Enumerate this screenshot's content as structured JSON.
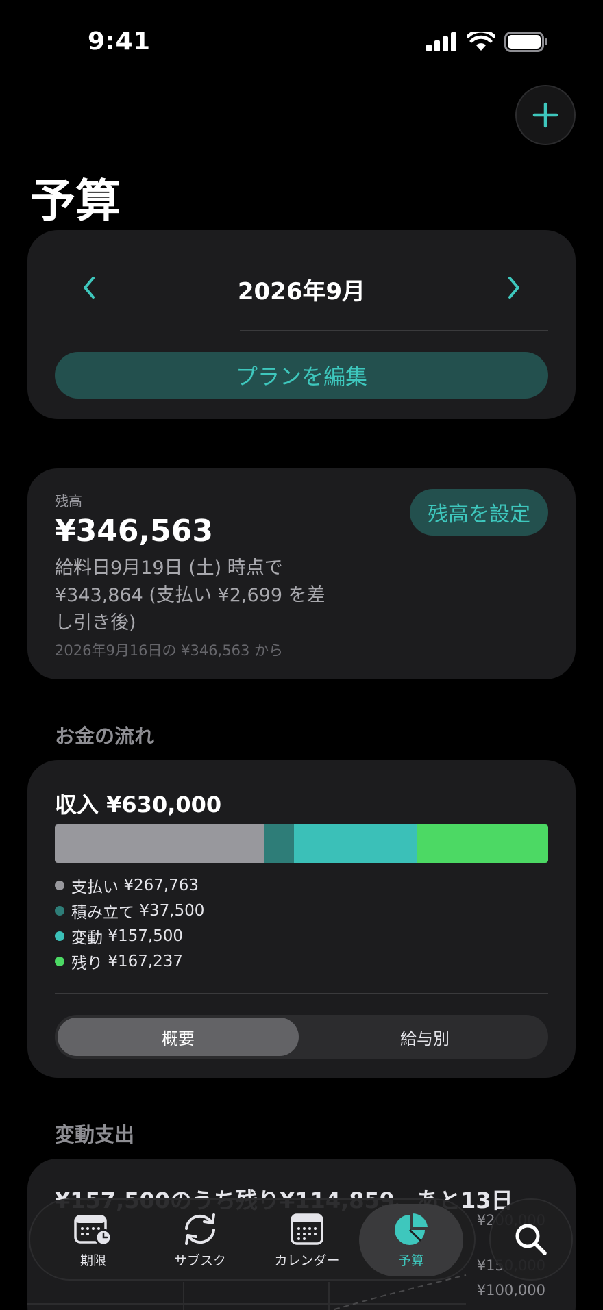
{
  "status": {
    "time": "9:41"
  },
  "page": {
    "title": "予算"
  },
  "month": {
    "label": "2026年9月",
    "edit_plan": "プランを編集"
  },
  "balance": {
    "label": "残高",
    "amount": "¥346,563",
    "description": "給料日9月19日 (土) 時点で ¥343,864 (支払い ¥2,699 を差し引き後)",
    "source": "2026年9月16日の ¥346,563 から",
    "set_button": "残高を設定"
  },
  "flow": {
    "section_title": "お金の流れ",
    "income_label": "収入 ¥630,000",
    "income_value": 630000,
    "legend": [
      {
        "label": "支払い",
        "amount": "¥267,763",
        "value": 267763,
        "color": "#98989d"
      },
      {
        "label": "積み立て",
        "amount": "¥37,500",
        "value": 37500,
        "color": "#2e7d78"
      },
      {
        "label": "変動",
        "amount": "¥157,500",
        "value": 157500,
        "color": "#3bc0b8"
      },
      {
        "label": "残り",
        "amount": "¥167,237",
        "value": 167237,
        "color": "#4cd964"
      }
    ],
    "toggle": {
      "options": [
        "概要",
        "給与別"
      ],
      "selected": "概要"
    }
  },
  "variable": {
    "section_title": "変動支出",
    "summary": "¥157,500のうち残り¥114,859、あと13日",
    "axis_ticks": [
      "¥200,000",
      "¥150,000",
      "¥100,000"
    ]
  },
  "tabs": [
    {
      "label": "期限",
      "icon": "calendar-clock-icon"
    },
    {
      "label": "サブスク",
      "icon": "refresh-icon"
    },
    {
      "label": "カレンダー",
      "icon": "calendar-icon"
    },
    {
      "label": "予算",
      "icon": "pie-chart-icon",
      "active": true
    }
  ],
  "search": {
    "icon": "search-icon"
  },
  "colors": {
    "accent": "#3ec7bd",
    "accent_bg": "#23504e",
    "card": "#1c1c1e",
    "background": "#000000"
  }
}
